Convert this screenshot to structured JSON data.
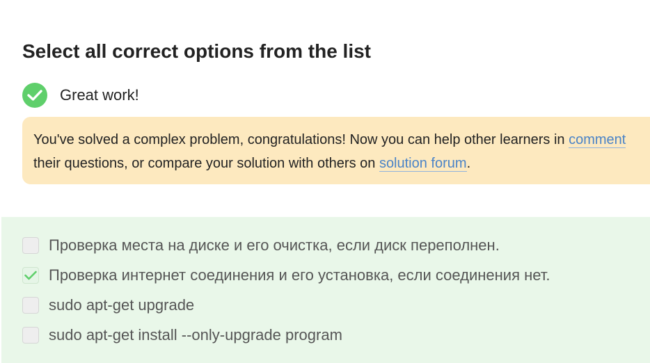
{
  "title": "Select all correct options from the list",
  "feedback": {
    "status_text": "Great work!",
    "status_icon": "check-circle-icon",
    "accent_color": "#5fcf6b",
    "hint_line1_pre": "You've solved a complex problem, congratulations! Now you can help other learners in ",
    "hint_link_comments": "comment",
    "hint_line2_pre": "their questions, or compare your solution with others on ",
    "hint_link_forum": "solution forum",
    "hint_line2_post": "."
  },
  "options": [
    {
      "label": "Проверка места на диске и его очистка, если диск переполнен.",
      "checked": false
    },
    {
      "label": "Проверка интернет соединения и его установка, если соединения нет.",
      "checked": true
    },
    {
      "label": "sudo apt-get upgrade",
      "checked": false
    },
    {
      "label": "sudo apt-get install --only-upgrade program",
      "checked": false
    }
  ]
}
